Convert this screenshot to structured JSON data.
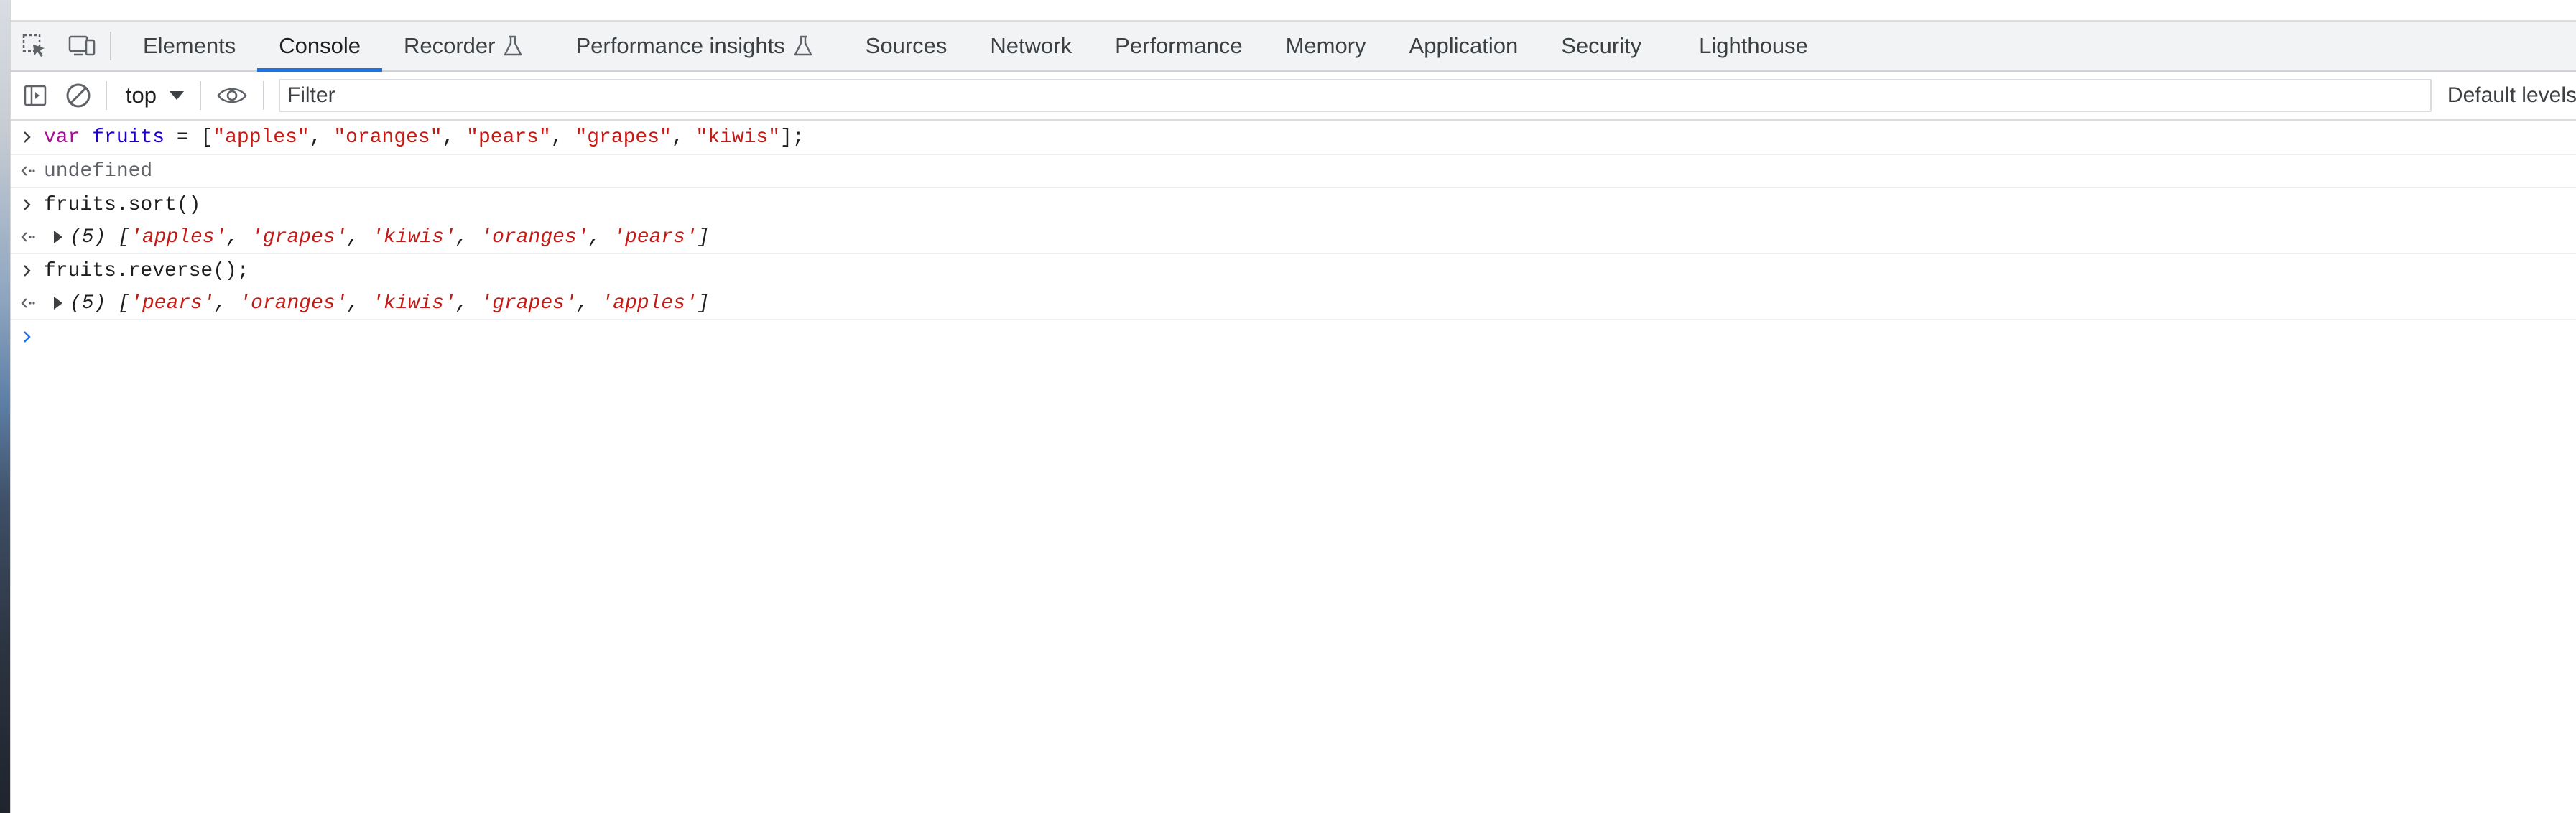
{
  "tabs": [
    {
      "label": "Elements"
    },
    {
      "label": "Console"
    },
    {
      "label": "Recorder"
    },
    {
      "label": "Performance insights"
    },
    {
      "label": "Sources"
    },
    {
      "label": "Network"
    },
    {
      "label": "Performance"
    },
    {
      "label": "Memory"
    },
    {
      "label": "Application"
    },
    {
      "label": "Security"
    },
    {
      "label": "Lighthouse"
    }
  ],
  "active_tab": "Console",
  "toolbar": {
    "context": "top",
    "filter_placeholder": "Filter",
    "levels_label": "Default levels"
  },
  "console": {
    "input1": {
      "kw": "var",
      "name": "fruits",
      "eq": " = [",
      "s1": "\"apples\"",
      "s2": "\"oranges\"",
      "s3": "\"pears\"",
      "s4": "\"grapes\"",
      "s5": "\"kiwis\"",
      "end": "];"
    },
    "output1": "undefined",
    "input2": "fruits.sort()",
    "output2": {
      "count": "(5)",
      "items": [
        "'apples'",
        "'grapes'",
        "'kiwis'",
        "'oranges'",
        "'pears'"
      ]
    },
    "input3": "fruits.reverse();",
    "output3": {
      "count": "(5)",
      "items": [
        "'pears'",
        "'oranges'",
        "'kiwis'",
        "'grapes'",
        "'apples'"
      ]
    }
  },
  "colors": {
    "accent": "#1a73e8",
    "keyword": "#aa0d91",
    "variable": "#1c00cf",
    "string": "#c41a16"
  },
  "icons": [
    "inspect-element-icon",
    "device-toolbar-icon",
    "flask-icon",
    "sidebar-toggle-icon",
    "clear-console-icon",
    "eye-icon",
    "prompt-chevron-icon",
    "result-arrow-icon",
    "expand-triangle-icon"
  ]
}
